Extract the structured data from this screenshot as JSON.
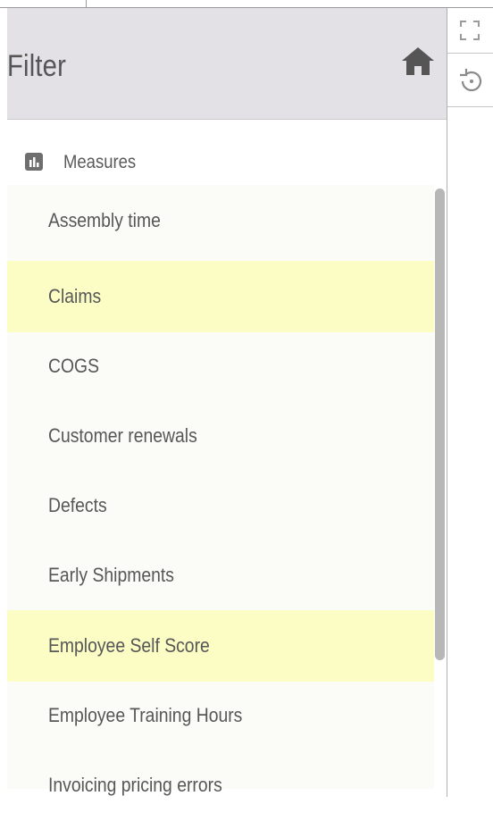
{
  "filter_panel": {
    "title": "Filter",
    "home_icon": "home-icon",
    "measures_label": "Measures",
    "measures_icon": "bar-chart-icon",
    "items": [
      {
        "label": "Assembly time",
        "highlighted": false
      },
      {
        "label": "Claims",
        "highlighted": true
      },
      {
        "label": "COGS",
        "highlighted": false
      },
      {
        "label": "Customer renewals",
        "highlighted": false
      },
      {
        "label": "Defects",
        "highlighted": false
      },
      {
        "label": "Early Shipments",
        "highlighted": false
      },
      {
        "label": "Employee Self Score",
        "highlighted": true
      },
      {
        "label": "Employee Training Hours",
        "highlighted": false
      },
      {
        "label": "Invoicing pricing errors",
        "highlighted": false
      }
    ]
  },
  "toolbar": {
    "expand_icon": "expand-icon",
    "reset_icon": "reset-icon"
  },
  "colors": {
    "header_bg": "#e3e1e6",
    "highlight": "#fbfdc5",
    "list_bg": "#fbfcf8",
    "text": "#575757"
  }
}
